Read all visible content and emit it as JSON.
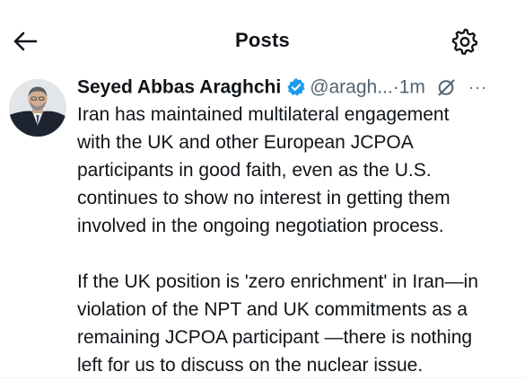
{
  "header": {
    "title": "Posts",
    "back_icon": "arrow-left-icon",
    "settings_icon": "gear-icon"
  },
  "post": {
    "author": {
      "name": "Seyed Abbas Araghchi",
      "handle": "@aragh...",
      "verified_icon": "verified-badge-icon",
      "verified_color": "#1d9bf0"
    },
    "separator": "·",
    "time": "1m",
    "grok_icon": "grok-icon",
    "more_label": "···",
    "paragraphs": [
      [
        "Iran has maintained multilateral engagement",
        "with the UK and other European JCPOA",
        "participants in good faith, even as the U.S.",
        "continues to show no interest in getting them",
        "involved in the ongoing negotiation process."
      ],
      [
        "If the UK position is 'zero enrichment' in Iran—in",
        "violation of the NPT and UK commitments as a",
        "remaining JCPOA participant —there is nothing",
        "left for us to discuss on the nuclear issue."
      ]
    ]
  }
}
